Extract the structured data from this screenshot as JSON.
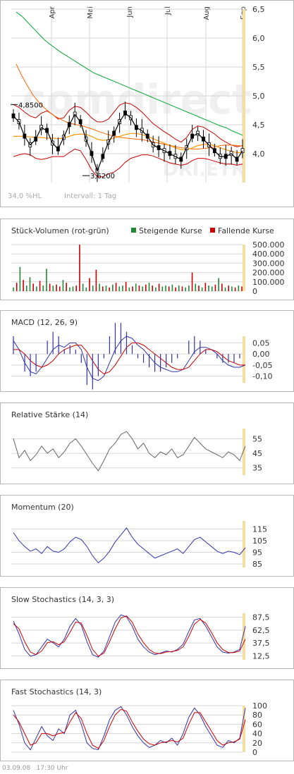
{
  "colors": {
    "price": "#000000",
    "bollinger": "#cc0000",
    "ma_slow": "#00aa33",
    "ma_mid": "#ff6600",
    "ma_fast": "#ff9900",
    "macd": "#3333aa",
    "signal": "#cc0000",
    "hist": "#3333aa",
    "rsi": "#666666",
    "momentum": "#3333aa",
    "stoch_k": "#3333aa",
    "stoch_d": "#cc0000",
    "vol_up": "#228833",
    "vol_down": "#cc0000",
    "highlight": "#f5dca0",
    "grid": "#d6d6d6"
  },
  "chart_data": [
    {
      "type": "line",
      "id": "price",
      "months": [
        "Apr",
        "Mai",
        "Jun",
        "Jul",
        "Aug",
        "Sep"
      ],
      "y_ticks": [
        "6,5",
        "6,0",
        "5,5",
        "5,0",
        "4,5",
        "4,0"
      ],
      "ylim": [
        3.5,
        6.5
      ],
      "annotations": {
        "high": "4,8500",
        "low": "3,6200"
      },
      "watermark": {
        "brand": "comdirect",
        "symbol": "DRI.ETR"
      },
      "footer_left": "34,0 %HL",
      "footer_right": "Intervall: 1 Tag",
      "series": [
        {
          "name": "close",
          "values": [
            4.65,
            4.55,
            4.3,
            4.15,
            4.25,
            4.45,
            4.4,
            4.18,
            4.08,
            4.28,
            4.5,
            4.68,
            4.55,
            4.25,
            4.0,
            3.7,
            3.95,
            4.2,
            4.35,
            4.55,
            4.7,
            4.62,
            4.45,
            4.4,
            4.3,
            4.15,
            4.1,
            4.05,
            4.0,
            3.95,
            3.9,
            4.1,
            4.3,
            4.35,
            4.25,
            4.15,
            4.05,
            3.95,
            3.95,
            4.0,
            3.9,
            4.05
          ]
        },
        {
          "name": "ma_slow",
          "values": [
            6.45,
            6.38,
            6.28,
            6.18,
            6.08,
            5.98,
            5.9,
            5.83,
            5.76,
            5.7,
            5.64,
            5.58,
            5.52,
            5.46,
            5.4,
            5.36,
            5.32,
            5.28,
            5.24,
            5.2,
            5.16,
            5.12,
            5.08,
            5.04,
            5.0,
            4.96,
            4.92,
            4.88,
            4.84,
            4.8,
            4.76,
            4.72,
            4.68,
            4.64,
            4.6,
            4.56,
            4.52,
            4.48,
            4.45,
            4.4,
            4.36,
            4.32
          ]
        },
        {
          "name": "ma_mid",
          "values": [
            5.55,
            5.35,
            5.18,
            5.02,
            4.9,
            4.8,
            4.72,
            4.65,
            4.6,
            4.55,
            4.52,
            4.5,
            4.48,
            4.45,
            4.42,
            4.38,
            4.35,
            4.32,
            4.3,
            4.28,
            4.27,
            4.26,
            4.25,
            4.24,
            4.22,
            4.2,
            4.18,
            4.16,
            4.14,
            4.12,
            4.1,
            4.09,
            4.08,
            4.08,
            4.09,
            4.1,
            4.12,
            4.14,
            4.15,
            4.15,
            4.14,
            4.13
          ]
        },
        {
          "name": "ma_fast",
          "values": [
            4.3,
            4.3,
            4.3,
            4.29,
            4.28,
            4.28,
            4.27,
            4.27,
            4.26,
            4.27,
            4.3,
            4.33,
            4.34,
            4.33,
            4.3,
            4.25,
            4.23,
            4.24,
            4.27,
            4.3,
            4.33,
            4.35,
            4.35,
            4.33,
            4.3,
            4.26,
            4.22,
            4.18,
            4.14,
            4.1,
            4.07,
            4.07,
            4.1,
            4.14,
            4.16,
            4.16,
            4.14,
            4.1,
            4.07,
            4.04,
            4.02,
            4.02
          ]
        },
        {
          "name": "boll_upper",
          "values": [
            4.85,
            4.8,
            4.72,
            4.65,
            4.62,
            4.7,
            4.74,
            4.68,
            4.6,
            4.62,
            4.75,
            4.82,
            4.8,
            4.72,
            4.62,
            4.55,
            4.55,
            4.6,
            4.72,
            4.84,
            4.88,
            4.86,
            4.8,
            4.72,
            4.62,
            4.52,
            4.45,
            4.38,
            4.32,
            4.25,
            4.2,
            4.28,
            4.42,
            4.48,
            4.46,
            4.4,
            4.34,
            4.26,
            4.2,
            4.15,
            4.12,
            4.14
          ]
        },
        {
          "name": "boll_lower",
          "values": [
            3.95,
            3.98,
            4.0,
            3.98,
            3.92,
            3.9,
            3.92,
            3.95,
            3.95,
            3.95,
            4.02,
            4.08,
            4.05,
            3.9,
            3.72,
            3.6,
            3.6,
            3.65,
            3.68,
            3.75,
            3.85,
            3.92,
            3.95,
            3.98,
            3.98,
            3.96,
            3.92,
            3.88,
            3.84,
            3.82,
            3.8,
            3.82,
            3.88,
            3.92,
            3.92,
            3.9,
            3.87,
            3.84,
            3.82,
            3.82,
            3.8,
            3.82
          ]
        }
      ]
    },
    {
      "type": "bar",
      "id": "volume",
      "title": "Stück-Volumen (rot-grün)",
      "legend": [
        {
          "label": "Steigende Kurse",
          "color": "#228833"
        },
        {
          "label": "Fallende Kurse",
          "color": "#cc0000"
        }
      ],
      "y_ticks": [
        "500.000",
        "400.000",
        "300.000",
        "200.000",
        "100.000",
        "0"
      ],
      "ylim": [
        0,
        500000
      ],
      "values": [
        40000,
        90000,
        260000,
        120000,
        60000,
        150000,
        80000,
        50000,
        110000,
        60000,
        240000,
        80000,
        60000,
        70000,
        50000,
        120000,
        90000,
        40000,
        50000,
        60000,
        520000,
        80000,
        40000,
        140000,
        60000,
        230000,
        80000,
        50000,
        60000,
        40000,
        70000,
        90000,
        50000,
        60000,
        100000,
        40000,
        50000,
        80000,
        60000,
        50000,
        70000,
        90000,
        60000,
        40000,
        80000,
        50000,
        60000,
        50000,
        70000,
        40000,
        60000,
        50000,
        40000,
        60000,
        200000,
        80000,
        60000,
        40000,
        90000,
        60000,
        50000,
        70000,
        140000,
        80000,
        40000,
        60000,
        50000,
        40000,
        60000,
        50000
      ],
      "up": [
        true,
        false,
        true,
        false,
        true,
        true,
        false,
        true,
        false,
        true,
        true,
        false,
        true,
        false,
        false,
        true,
        false,
        true,
        true,
        false,
        false,
        true,
        true,
        false,
        true,
        false,
        true,
        false,
        true,
        false,
        true,
        false,
        true,
        true,
        false,
        true,
        false,
        true,
        false,
        true,
        false,
        true,
        false,
        true,
        false,
        true,
        true,
        false,
        true,
        false,
        true,
        false,
        true,
        true,
        false,
        true,
        false,
        true,
        false,
        true,
        true,
        false,
        true,
        false,
        true,
        false,
        true,
        false,
        true,
        false
      ]
    },
    {
      "type": "line",
      "id": "macd",
      "title": "MACD (12, 26, 9)",
      "y_ticks": [
        "0,05",
        "0,00",
        "-0,05",
        "-0,10"
      ],
      "ylim": [
        -0.13,
        0.08
      ],
      "series": [
        {
          "name": "macd",
          "values": [
            0.06,
            0.02,
            -0.04,
            -0.08,
            -0.09,
            -0.06,
            -0.02,
            0.02,
            0.04,
            0.03,
            0.05,
            0.05,
            0.02,
            -0.06,
            -0.11,
            -0.12,
            -0.1,
            -0.04,
            0.02,
            0.06,
            0.08,
            0.07,
            0.04,
            0.02,
            -0.01,
            -0.04,
            -0.06,
            -0.07,
            -0.08,
            -0.08,
            -0.07,
            -0.03,
            0.01,
            0.03,
            0.03,
            0.02,
            0.0,
            -0.03,
            -0.05,
            -0.06,
            -0.06,
            -0.05
          ]
        },
        {
          "name": "signal",
          "values": [
            0.02,
            0.02,
            0.0,
            -0.03,
            -0.05,
            -0.06,
            -0.05,
            -0.03,
            0.0,
            0.02,
            0.03,
            0.04,
            0.04,
            0.01,
            -0.03,
            -0.07,
            -0.09,
            -0.08,
            -0.05,
            -0.01,
            0.03,
            0.05,
            0.05,
            0.04,
            0.02,
            0.0,
            -0.02,
            -0.04,
            -0.06,
            -0.07,
            -0.07,
            -0.06,
            -0.03,
            0.0,
            0.02,
            0.02,
            0.01,
            -0.01,
            -0.03,
            -0.04,
            -0.05,
            -0.05
          ]
        }
      ]
    },
    {
      "type": "line",
      "id": "rsi",
      "title": "Relative Stärke (14)",
      "y_ticks": [
        "55",
        "45",
        "35"
      ],
      "ylim": [
        30,
        62
      ],
      "values": [
        55,
        42,
        47,
        40,
        44,
        50,
        45,
        48,
        42,
        46,
        52,
        55,
        50,
        44,
        38,
        33,
        40,
        48,
        52,
        58,
        60,
        55,
        48,
        52,
        45,
        42,
        46,
        44,
        48,
        42,
        44,
        50,
        56,
        52,
        48,
        46,
        44,
        42,
        46,
        44,
        40,
        50
      ]
    },
    {
      "type": "line",
      "id": "momentum",
      "title": "Momentum (20)",
      "y_ticks": [
        "115",
        "105",
        "95",
        "85"
      ],
      "ylim": [
        82,
        122
      ],
      "values": [
        112,
        105,
        100,
        96,
        98,
        94,
        100,
        96,
        95,
        98,
        104,
        108,
        106,
        100,
        92,
        86,
        90,
        96,
        104,
        110,
        116,
        108,
        102,
        98,
        94,
        90,
        92,
        94,
        96,
        98,
        94,
        100,
        106,
        108,
        104,
        100,
        96,
        94,
        96,
        95,
        93,
        99
      ]
    },
    {
      "type": "line",
      "id": "slow_stochastics",
      "title": "Slow Stochastics (14, 3, 3)",
      "y_ticks": [
        "87,5",
        "62,5",
        "37,5",
        "12,5"
      ],
      "ylim": [
        5,
        95
      ],
      "series": [
        {
          "name": "k",
          "values": [
            80,
            55,
            25,
            12,
            15,
            30,
            45,
            38,
            30,
            45,
            70,
            85,
            72,
            40,
            15,
            10,
            22,
            50,
            78,
            92,
            88,
            70,
            45,
            30,
            20,
            15,
            18,
            22,
            20,
            25,
            35,
            60,
            82,
            85,
            70,
            50,
            30,
            20,
            18,
            20,
            25,
            70
          ]
        },
        {
          "name": "d",
          "values": [
            75,
            65,
            40,
            20,
            15,
            22,
            38,
            40,
            34,
            40,
            58,
            78,
            76,
            52,
            25,
            12,
            18,
            40,
            65,
            86,
            90,
            78,
            55,
            38,
            25,
            18,
            17,
            20,
            21,
            23,
            30,
            50,
            74,
            83,
            76,
            58,
            38,
            25,
            19,
            19,
            22,
            45
          ]
        }
      ]
    },
    {
      "type": "line",
      "id": "fast_stochastics",
      "title": "Fast Stochastics (14, 3)",
      "y_ticks": [
        "100",
        "80",
        "60",
        "40",
        "20",
        "0"
      ],
      "ylim": [
        0,
        100
      ],
      "series": [
        {
          "name": "k",
          "values": [
            90,
            60,
            20,
            5,
            30,
            55,
            35,
            25,
            50,
            40,
            80,
            90,
            60,
            20,
            8,
            5,
            35,
            70,
            90,
            98,
            80,
            55,
            35,
            20,
            10,
            15,
            25,
            20,
            30,
            15,
            40,
            75,
            95,
            80,
            55,
            35,
            15,
            10,
            25,
            20,
            30,
            95
          ]
        },
        {
          "name": "d",
          "values": [
            80,
            65,
            40,
            15,
            20,
            40,
            40,
            35,
            40,
            42,
            65,
            85,
            72,
            40,
            15,
            8,
            25,
            55,
            80,
            92,
            88,
            65,
            45,
            28,
            18,
            15,
            20,
            22,
            25,
            22,
            30,
            60,
            85,
            85,
            65,
            45,
            25,
            15,
            20,
            22,
            28,
            70
          ]
        }
      ]
    }
  ],
  "footer": {
    "timestamp": "03.09.08",
    "time": "17:30 Uhr"
  }
}
